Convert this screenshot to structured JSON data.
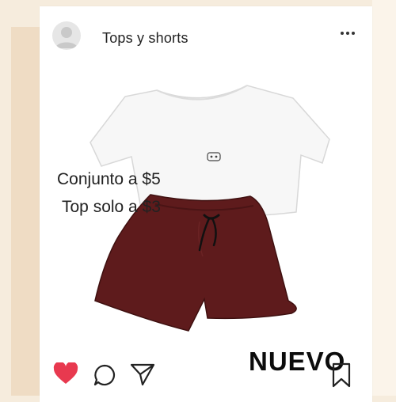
{
  "post": {
    "title": "Tops y shorts",
    "caption_line1": "Conjunto a $5",
    "caption_line2": "Top solo a $3",
    "badge": "NUEVO"
  },
  "icons": {
    "avatar": "user-avatar-icon",
    "more": "more-horizontal-icon",
    "like": "heart-icon",
    "comment": "comment-bubble-icon",
    "share": "paper-plane-icon",
    "save": "bookmark-icon"
  },
  "colors": {
    "heart": "#e8394f",
    "shorts": "#5e1b1c",
    "top": "#f7f7f7",
    "background": "#f6ecdd"
  }
}
